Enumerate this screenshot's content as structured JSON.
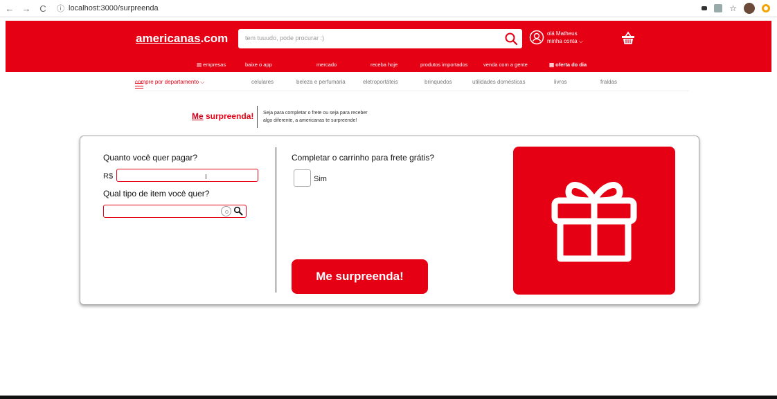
{
  "browser": {
    "url": "localhost:3000/surpreenda"
  },
  "header": {
    "logo": "americanas",
    "logo_suffix": ".com",
    "search_placeholder": "tem tuuudo, pode procurar :)",
    "greeting": "olá Matheus",
    "account_link": "minha conta",
    "nav": [
      "empresas",
      "baixe o app",
      "mercado",
      "receba hoje",
      "produtos importados",
      "venda com a gente",
      "oferta do dia"
    ]
  },
  "departments": {
    "main": "compre por departamento",
    "items": [
      "celulares",
      "beleza e perfumaria",
      "eletroportáteis",
      "brinquedos",
      "utilidades domésticas",
      "livros",
      "fraldas"
    ]
  },
  "brand": {
    "title_a": "Me",
    "title_b": " surpreenda!",
    "desc_line1": "Seja para completar o frete ou seja para receber",
    "desc_line2": "algo diferente, a americanas te surpreende!"
  },
  "form": {
    "price_label": "Quanto você quer pagar?",
    "currency": "R$",
    "price_value": "",
    "type_label": "Qual tipo de item você quer?",
    "type_value": "",
    "cart_label": "Completar o carrinho para frete grátis?",
    "checkbox_label": "Sim",
    "cta_label": "Me surpreenda!"
  },
  "colors": {
    "brand_red": "#e60014"
  }
}
